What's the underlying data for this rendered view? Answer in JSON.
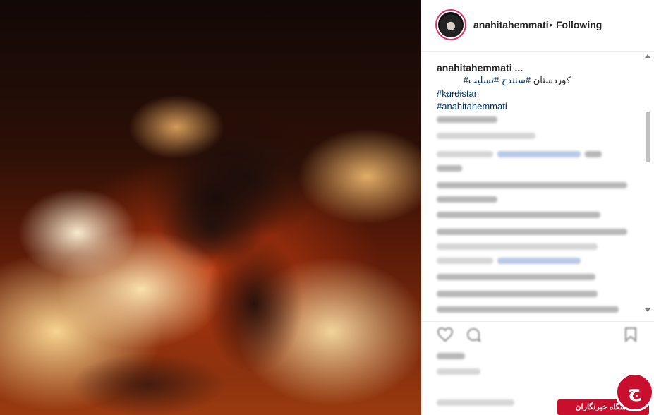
{
  "post": {
    "author": "anahitahemmati",
    "separator": "•",
    "follow_status": "Following"
  },
  "caption": {
    "user": "anahitahemmati ...",
    "rtl_parts": [
      "کوردستان",
      "#سنندج",
      "#تسلیت#"
    ],
    "dots": "............",
    "tags": [
      "#kurdistan",
      "#anahitahemmati"
    ]
  },
  "icons": {
    "like": "heart-icon",
    "comment": "comment-icon",
    "save": "bookmark-icon",
    "scroll_up": "arrow-up-icon",
    "scroll_down": "arrow-down-icon"
  },
  "watermark": {
    "logo_char": "ج",
    "text": "باشگاه خبرنگاران"
  },
  "colors": {
    "accent_ring": "#e1306c",
    "link": "#003569",
    "watermark": "#c8102e"
  }
}
